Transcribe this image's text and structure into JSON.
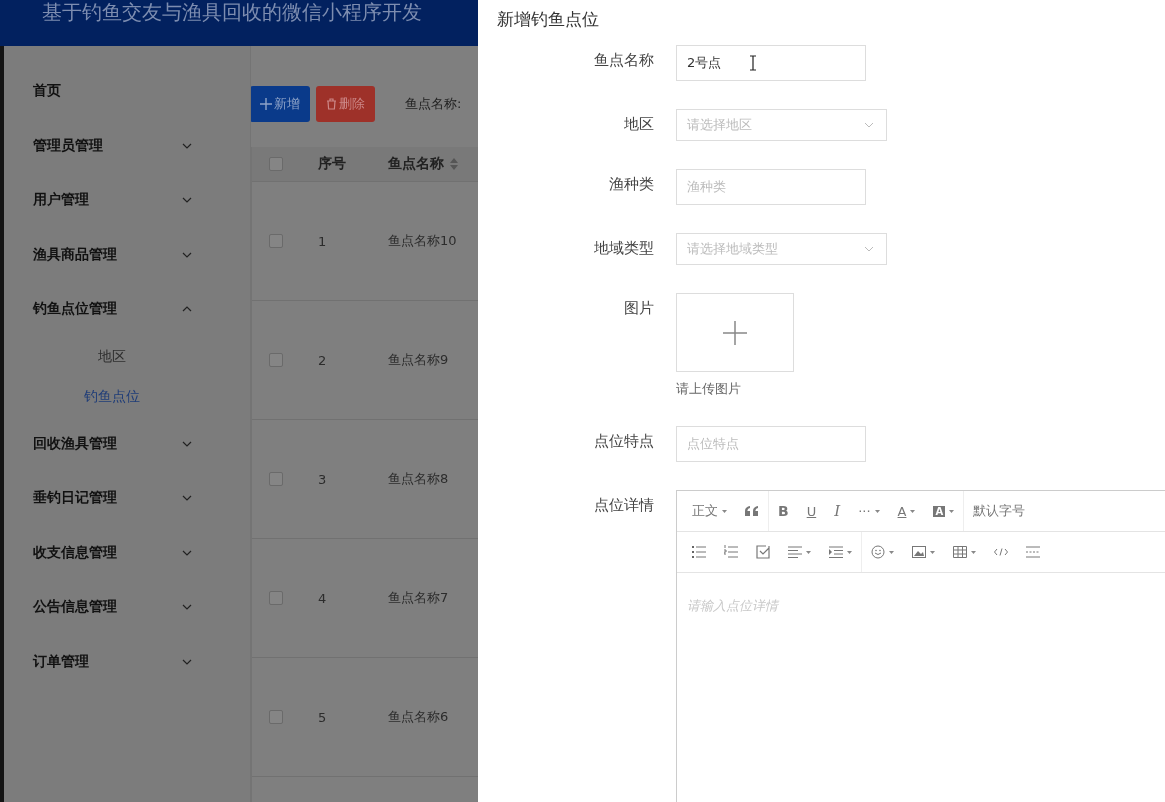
{
  "header": {
    "title": "基于钓鱼交友与渔具回收的微信小程序开发"
  },
  "sidebar": {
    "items": [
      {
        "label": "首页",
        "kind": "link"
      },
      {
        "label": "管理员管理",
        "kind": "menu",
        "expanded": false
      },
      {
        "label": "用户管理",
        "kind": "menu",
        "expanded": false
      },
      {
        "label": "渔具商品管理",
        "kind": "menu",
        "expanded": false
      },
      {
        "label": "钓鱼点位管理",
        "kind": "menu",
        "expanded": true,
        "children": [
          {
            "label": "地区",
            "selected": false
          },
          {
            "label": "钓鱼点位",
            "selected": true
          }
        ]
      },
      {
        "label": "回收渔具管理",
        "kind": "menu",
        "expanded": false
      },
      {
        "label": "垂钓日记管理",
        "kind": "menu",
        "expanded": false
      },
      {
        "label": "收支信息管理",
        "kind": "menu",
        "expanded": false
      },
      {
        "label": "公告信息管理",
        "kind": "menu",
        "expanded": false
      },
      {
        "label": "订单管理",
        "kind": "menu",
        "expanded": false
      }
    ]
  },
  "toolbar": {
    "buttons": [
      {
        "label": "新增",
        "kind": "add"
      },
      {
        "label": "删除",
        "kind": "delete"
      }
    ],
    "search_label": "鱼点名称:"
  },
  "table": {
    "all_checked": false,
    "columns": [
      "序号",
      "鱼点名称"
    ],
    "rows": [
      {
        "index": "1",
        "name": "鱼点名称10",
        "checked": false
      },
      {
        "index": "2",
        "name": "鱼点名称9",
        "checked": false
      },
      {
        "index": "3",
        "name": "鱼点名称8",
        "checked": false
      },
      {
        "index": "4",
        "name": "鱼点名称7",
        "checked": false
      },
      {
        "index": "5",
        "name": "鱼点名称6",
        "checked": false
      }
    ]
  },
  "drawer": {
    "title": "新增钓鱼点位",
    "fields": [
      {
        "label": "鱼点名称",
        "kind": "input",
        "value": "2号点"
      },
      {
        "label": "地区",
        "kind": "select",
        "placeholder": "请选择地区"
      },
      {
        "label": "渔种类",
        "kind": "input",
        "placeholder": "渔种类"
      },
      {
        "label": "地域类型",
        "kind": "select",
        "placeholder": "请选择地域类型"
      },
      {
        "label": "图片",
        "kind": "upload",
        "hint": "请上传图片"
      },
      {
        "label": "点位特点",
        "kind": "input",
        "placeholder": "点位特点"
      },
      {
        "label": "点位详情",
        "kind": "editor",
        "placeholder": "请输入点位详情"
      }
    ],
    "editor_toolbar": [
      [
        [
          {
            "kind": "text",
            "label": "正文",
            "caret": true
          },
          {
            "kind": "quote",
            "caret": false
          }
        ],
        [
          {
            "kind": "bold",
            "label": "B",
            "caret": false
          },
          {
            "kind": "underline",
            "label": "U",
            "caret": false
          },
          {
            "kind": "italic",
            "label": "I",
            "caret": false
          },
          {
            "kind": "text",
            "label": "···",
            "caret": true
          },
          {
            "kind": "underline",
            "label": "A",
            "caret": true
          },
          {
            "kind": "highlight",
            "label": "A",
            "caret": true
          }
        ],
        [
          {
            "kind": "text",
            "label": "默认字号",
            "caret": false
          }
        ]
      ],
      [
        [
          {
            "kind": "list",
            "caret": false
          },
          {
            "kind": "ordered",
            "caret": false
          },
          {
            "kind": "todo",
            "caret": false
          },
          {
            "kind": "align",
            "caret": true
          },
          {
            "kind": "indent",
            "caret": true
          }
        ],
        [
          {
            "kind": "emoji",
            "caret": true
          },
          {
            "kind": "image",
            "caret": true
          },
          {
            "kind": "table",
            "caret": true
          },
          {
            "kind": "code",
            "caret": false
          },
          {
            "kind": "divider",
            "caret": false
          }
        ]
      ]
    ]
  }
}
